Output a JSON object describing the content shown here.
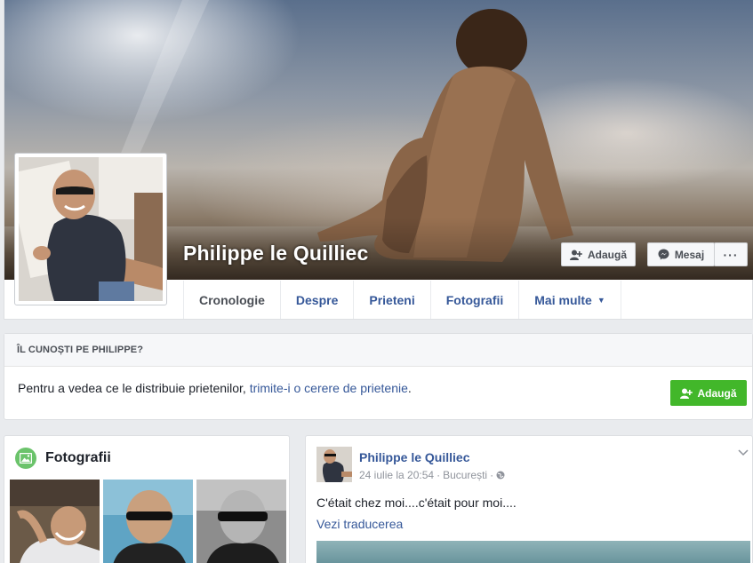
{
  "profile": {
    "name": "Philippe le Quilliec"
  },
  "cover_buttons": {
    "add_label": "Adaugă",
    "message_label": "Mesaj",
    "more_label": "···"
  },
  "tabs": [
    {
      "label": "Cronologie",
      "active": true
    },
    {
      "label": "Despre"
    },
    {
      "label": "Prieteni"
    },
    {
      "label": "Fotografii"
    },
    {
      "label": "Mai multe"
    }
  ],
  "know_panel": {
    "heading": "ÎL CUNOȘTI PE PHILIPPE?",
    "text": "Pentru a vedea ce le distribuie prietenilor, ",
    "link": "trimite-i o cerere de prietenie",
    "text_end": ".",
    "button_label": "Adaugă"
  },
  "photos_card": {
    "title": "Fotografii"
  },
  "post": {
    "author": "Philippe le Quilliec",
    "date": "24 iulie la 20:54",
    "separator": "·",
    "location": "București",
    "privacy_separator": "·",
    "text": "C'était chez moi....c'était pour moi....",
    "translate_link": "Vezi traducerea"
  },
  "colors": {
    "link": "#365899",
    "green_button": "#42b72a",
    "page_bg": "#e9ebee"
  },
  "icons": [
    "add-friend-icon",
    "messenger-icon",
    "more-icon",
    "dropdown-caret-icon",
    "photos-icon",
    "globe-icon",
    "chevron-down-icon"
  ]
}
